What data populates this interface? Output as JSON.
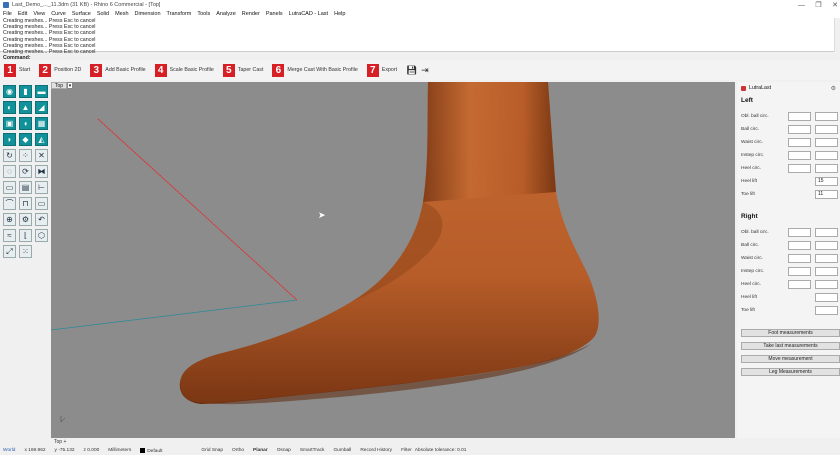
{
  "window": {
    "title": "Last_Demo_..._11.3dm (31 KB) - Rhino 6 Commercial - [Top]",
    "controls": [
      "—",
      "❐",
      "✕"
    ]
  },
  "menu": [
    "File",
    "Edit",
    "View",
    "Curve",
    "Surface",
    "Solid",
    "Mesh",
    "Dimension",
    "Transform",
    "Tools",
    "Analyze",
    "Render",
    "Panels",
    "LutraCAD - Last",
    "Help"
  ],
  "command_history": [
    "Creating meshes... Press Esc to cancel",
    "Creating meshes... Press Esc to cancel",
    "Creating meshes... Press Esc to cancel",
    "Creating meshes... Press Esc to cancel",
    "Creating meshes... Press Esc to cancel",
    "Creating meshes... Press Esc to cancel"
  ],
  "command_prompt": "Command:",
  "steps": [
    {
      "num": "1",
      "label": "Start"
    },
    {
      "num": "2",
      "label": "Position 2D"
    },
    {
      "num": "3",
      "label": "Add Basic Profile"
    },
    {
      "num": "4",
      "label": "Scale Basic Profile"
    },
    {
      "num": "5",
      "label": "Taper Cast"
    },
    {
      "num": "6",
      "label": "Merge Cast With Basic Profile"
    },
    {
      "num": "7",
      "label": "Export"
    }
  ],
  "toolbar_icons": [
    "save-icon",
    "export-icon"
  ],
  "viewport": {
    "name": "Top",
    "dropdown": "▾"
  },
  "viewport_tabs": "Top    +",
  "panel": {
    "title": "LutraLast",
    "left_title": "Left",
    "left_rows": [
      {
        "label": "Obl. ball circ.",
        "v1": "",
        "v2": ""
      },
      {
        "label": "Ball circ.",
        "v1": "",
        "v2": ""
      },
      {
        "label": "Waist circ.",
        "v1": "",
        "v2": ""
      },
      {
        "label": "Instep circ.",
        "v1": "",
        "v2": ""
      },
      {
        "label": "Heel circ.",
        "v1": "",
        "v2": ""
      },
      {
        "label": "Heel lift",
        "v2": "15"
      },
      {
        "label": "Toe lift",
        "v2": "11"
      }
    ],
    "right_title": "Right",
    "right_rows": [
      {
        "label": "Obl. ball circ.",
        "v1": "",
        "v2": ""
      },
      {
        "label": "Ball circ.",
        "v1": "",
        "v2": ""
      },
      {
        "label": "Waist circ.",
        "v1": "",
        "v2": ""
      },
      {
        "label": "Instep circ.",
        "v1": "",
        "v2": ""
      },
      {
        "label": "Heel circ.",
        "v1": "",
        "v2": ""
      },
      {
        "label": "Heel lift",
        "v2": ""
      },
      {
        "label": "Toe lift",
        "v2": ""
      }
    ],
    "buttons": [
      "Foot measurements",
      "Take last measurements",
      "Move measurement",
      "Leg Measurements"
    ]
  },
  "status": {
    "cplane": "World",
    "x": "x 169.962",
    "y": "y -75.132",
    "z": "z 0.000",
    "units": "Millimeters",
    "layer": "Default",
    "toggles": [
      "Grid Snap",
      "Ortho",
      "Planar",
      "Osnap",
      "SmartTrack",
      "Gumball",
      "Record History",
      "Filter"
    ],
    "tolerance": "Absolute tolerance: 0.01"
  },
  "colors": {
    "step_red": "#d71f26",
    "tool_teal": "#11929a",
    "foot": "#c0652f",
    "viewport_bg": "#8c8c8c",
    "curve_red": "#e03030",
    "curve_teal": "#2a8a9a"
  }
}
